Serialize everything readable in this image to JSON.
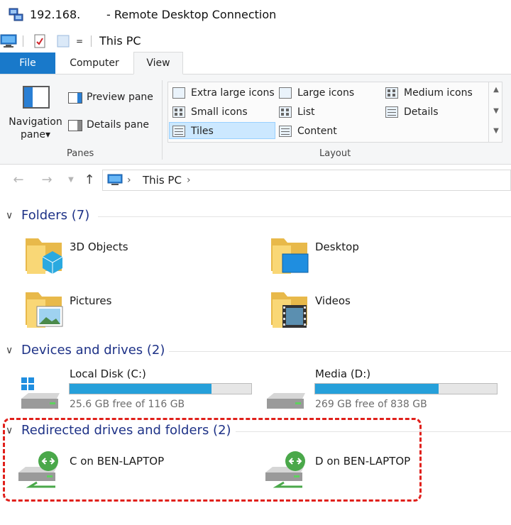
{
  "window": {
    "ip": "192.168.",
    "app_title": "- Remote Desktop Connection"
  },
  "quick_access": {
    "title": "This PC",
    "dropdown": "="
  },
  "ribbon": {
    "tabs": [
      "File",
      "Computer",
      "View"
    ],
    "active_tab": "View",
    "panes": {
      "navigation_pane": "Navigation pane",
      "preview_pane": "Preview pane",
      "details_pane": "Details pane",
      "group_label": "Panes"
    },
    "layout": {
      "items": [
        "Extra large icons",
        "Large icons",
        "Medium icons",
        "Small icons",
        "List",
        "Details",
        "Tiles",
        "Content"
      ],
      "selected": "Tiles",
      "group_label": "Layout"
    }
  },
  "address": {
    "path": "This PC"
  },
  "sections": {
    "folders": {
      "title": "Folders (7)",
      "items": [
        "3D Objects",
        "Desktop",
        "Pictures",
        "Videos"
      ]
    },
    "devices": {
      "title": "Devices and drives (2)",
      "drives": [
        {
          "name": "Local Disk (C:)",
          "free": "25.6 GB free of 116 GB",
          "used_fraction": 0.78
        },
        {
          "name": "Media (D:)",
          "free": "269 GB free of 838 GB",
          "used_fraction": 0.68
        }
      ]
    },
    "redirected": {
      "title": "Redirected drives and folders (2)",
      "items": [
        "C on BEN-LAPTOP",
        "D on BEN-LAPTOP"
      ]
    }
  },
  "colors": {
    "accent": "#1979ca",
    "section_heading": "#1e3287",
    "drive_bar": "#26a0da",
    "highlight_box": "#e0201b"
  }
}
